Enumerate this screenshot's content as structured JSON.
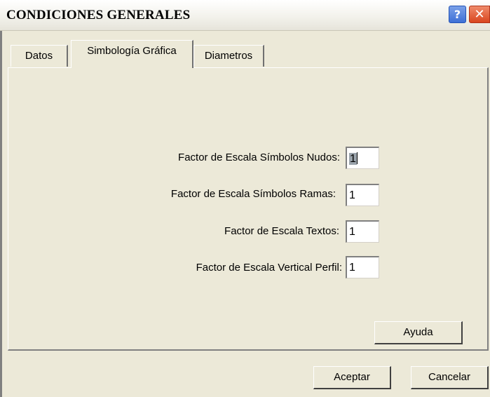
{
  "window": {
    "title": "CONDICIONES GENERALES",
    "help_glyph": "?",
    "close_glyph": "✕"
  },
  "tabs": [
    {
      "label": "Datos",
      "active": false
    },
    {
      "label": "Simbología Gráfica",
      "active": true
    },
    {
      "label": "Diametros",
      "active": false
    }
  ],
  "fields": [
    {
      "label": "Factor de Escala Símbolos Nudos:",
      "value": "1"
    },
    {
      "label": "Factor de Escala Símbolos Ramas:",
      "value": "1"
    },
    {
      "label": "Factor de Escala Textos:",
      "value": "1"
    },
    {
      "label": "Factor de Escala Vertical Perfil:",
      "value": "1"
    }
  ],
  "buttons": {
    "help": "Ayuda",
    "ok": "Aceptar",
    "cancel": "Cancelar"
  },
  "icons": {
    "help": "question-mark-icon",
    "close": "close-x-icon"
  }
}
